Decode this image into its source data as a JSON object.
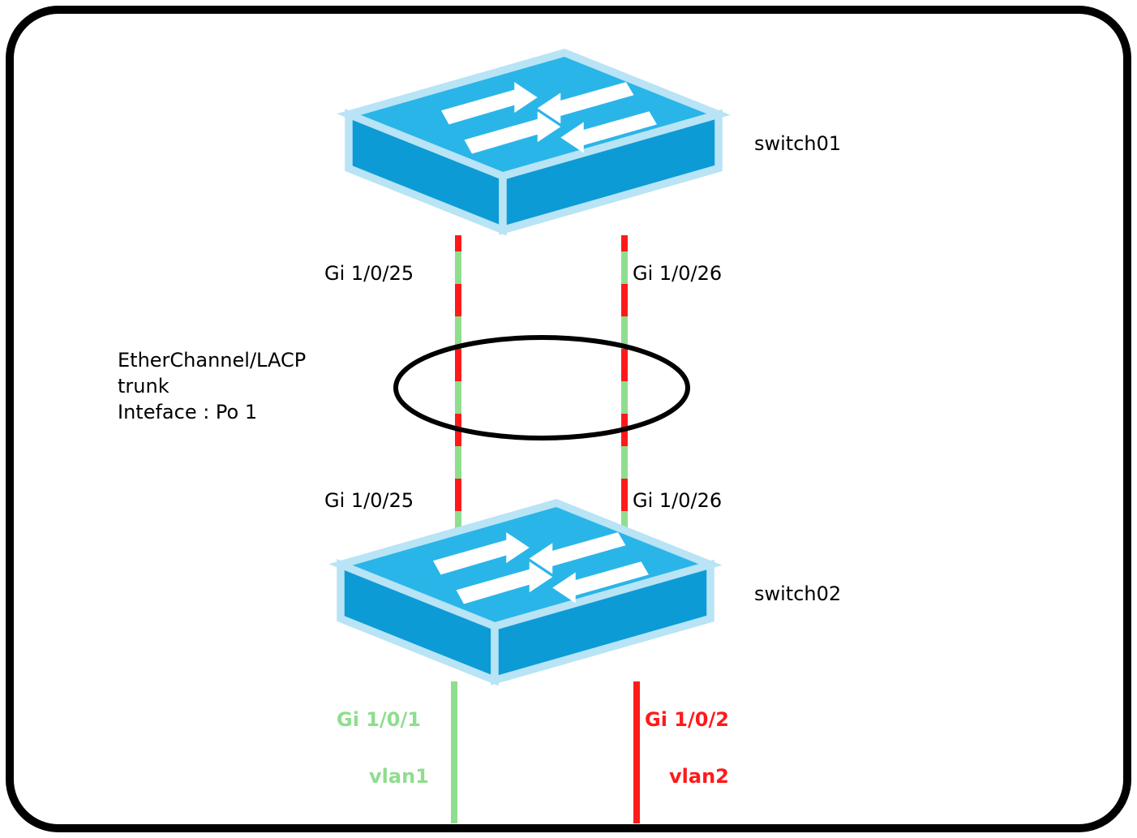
{
  "switches": {
    "top": {
      "name": "switch01",
      "port_left": "Gi 1/0/25",
      "port_right": "Gi 1/0/26"
    },
    "bottom": {
      "name": "switch02",
      "port_left": "Gi 1/0/25",
      "port_right": "Gi 1/0/26"
    }
  },
  "etherchannel": {
    "line1": "EtherChannel/LACP",
    "line2": "trunk",
    "line3": "Inteface : Po 1"
  },
  "access": {
    "left": {
      "port": "Gi 1/0/1",
      "vlan": "vlan1",
      "color": "#8fdd8f"
    },
    "right": {
      "port": "Gi 1/0/2",
      "vlan": "vlan2",
      "color": "#ff1a1a"
    }
  },
  "colors": {
    "switch_top": "#2ab5e9",
    "switch_side": "#0d9bd6",
    "switch_edge": "#b8e4f5",
    "green": "#8fdd8f",
    "red": "#ff1a1a",
    "black": "#000000"
  }
}
